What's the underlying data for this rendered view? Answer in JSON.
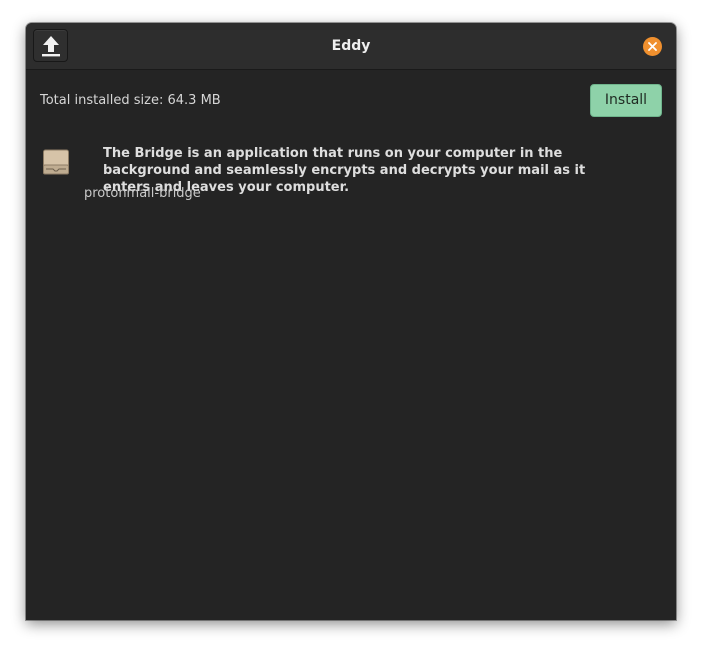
{
  "window": {
    "title": "Eddy"
  },
  "titlebar": {
    "upload_icon": "upload-arrow-icon",
    "close_icon": "close-icon"
  },
  "summary": {
    "installed_size_label": "Total installed size: 64.3 MB"
  },
  "actions": {
    "install_label": "Install",
    "install_color": "#8ed2a9"
  },
  "package": {
    "icon": "package-box-icon",
    "description": "The Bridge is an application that runs on your computer in the background and seamlessly encrypts and decrypts your mail as it enters and leaves your computer.",
    "name": "protonmail-bridge"
  },
  "colors": {
    "close_button": "#f0902e",
    "background": "#242424",
    "titlebar": "#2d2d2d"
  }
}
